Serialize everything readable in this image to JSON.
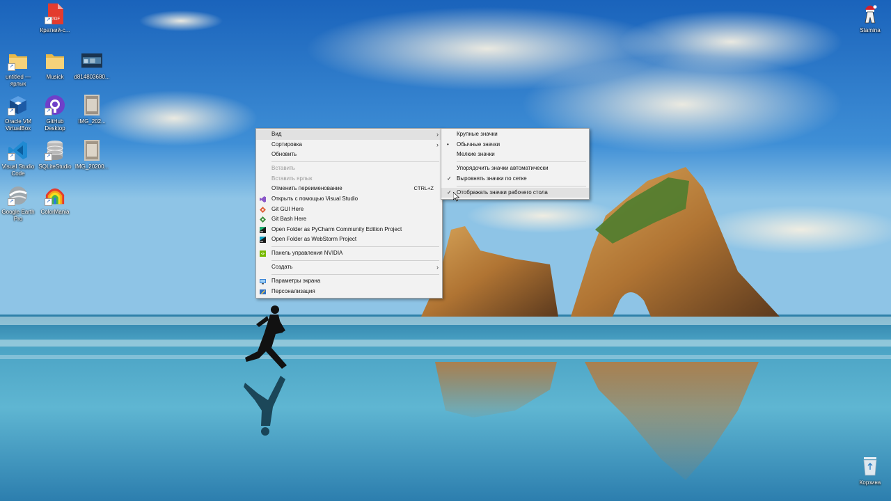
{
  "desktop": {
    "icons": [
      {
        "label": "Краткий-с...",
        "icon": "pdf-icon"
      },
      {
        "label": "untitled — ярлык",
        "icon": "folder-icon"
      },
      {
        "label": "Musick",
        "icon": "folder-icon"
      },
      {
        "label": "d814803680...",
        "icon": "image-thumbnail-icon"
      },
      {
        "label": "Oracle VM VirtualBox",
        "icon": "virtualbox-icon"
      },
      {
        "label": "GitHub Desktop",
        "icon": "github-icon"
      },
      {
        "label": "IMG_202...",
        "icon": "image-thumbnail-icon"
      },
      {
        "label": "Visual Studio Code",
        "icon": "vscode-icon"
      },
      {
        "label": "SQLiteStudio",
        "icon": "database-icon"
      },
      {
        "label": "IMG_20200...",
        "icon": "image-thumbnail-icon"
      },
      {
        "label": "Google Earth Pro",
        "icon": "google-earth-icon"
      },
      {
        "label": "ColorMania",
        "icon": "colormania-icon"
      },
      {
        "label": "Stamina",
        "icon": "stamina-icon"
      },
      {
        "label": "Корзина",
        "icon": "recycle-bin-icon"
      }
    ]
  },
  "context_menu": {
    "items": [
      {
        "label": "Вид",
        "submenu": true
      },
      {
        "label": "Сортировка",
        "submenu": true
      },
      {
        "label": "Обновить"
      },
      {
        "label": "Вставить",
        "disabled": true
      },
      {
        "label": "Вставить ярлык",
        "disabled": true
      },
      {
        "label": "Отменить переименование",
        "shortcut": "CTRL+Z"
      },
      {
        "label": "Открыть с помощью Visual Studio",
        "icon": "visual-studio-icon"
      },
      {
        "label": "Git GUI Here",
        "icon": "git-gui-icon"
      },
      {
        "label": "Git Bash Here",
        "icon": "git-bash-icon"
      },
      {
        "label": "Open Folder as PyCharm Community Edition Project",
        "icon": "pycharm-icon"
      },
      {
        "label": "Open Folder as WebStorm Project",
        "icon": "webstorm-icon"
      },
      {
        "label": "Панель управления NVIDIA",
        "icon": "nvidia-icon"
      },
      {
        "label": "Создать",
        "submenu": true
      },
      {
        "label": "Параметры экрана",
        "icon": "display-settings-icon"
      },
      {
        "label": "Персонализация",
        "icon": "personalization-icon"
      }
    ]
  },
  "view_submenu": {
    "items": [
      {
        "label": "Крупные значки"
      },
      {
        "label": "Обычные значки",
        "mark": "•"
      },
      {
        "label": "Мелкие значки"
      },
      {
        "label": "Упорядочить значки автоматически"
      },
      {
        "label": "Выровнять значки по сетке",
        "mark": "✓"
      },
      {
        "label": "Отображать значки рабочего стола",
        "mark": "✓"
      }
    ]
  },
  "colors": {
    "menu_bg": "#f2f2f2",
    "menu_hover": "#e1e1e1",
    "menu_disabled": "#9a9a9a",
    "sky_top": "#1f6fc4",
    "sea": "#3f9fc0"
  }
}
